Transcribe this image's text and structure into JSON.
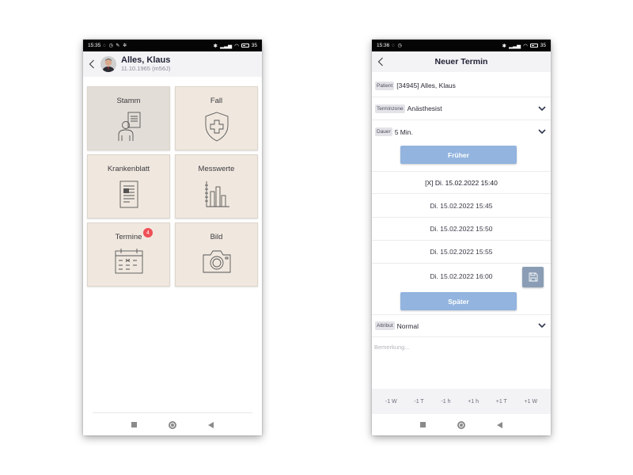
{
  "colors": {
    "tile_bg": "#f0e8df",
    "tile_active_bg": "#e2ddd6",
    "badge": "#ef4f55",
    "button_blue": "#92b4de",
    "save_button": "#8a9db5",
    "header_bg": "#f3f3f6"
  },
  "phone1": {
    "status": {
      "time": "15:35",
      "battery": "35"
    },
    "header": {
      "name": "Alles, Klaus",
      "sub": "11.10.1965 (m56J)"
    },
    "tiles": [
      {
        "label": "Stamm",
        "icon": "person-document-icon"
      },
      {
        "label": "Fall",
        "icon": "shield-cross-icon"
      },
      {
        "label": "Krankenblatt",
        "icon": "document-icon"
      },
      {
        "label": "Messwerte",
        "icon": "bar-chart-icon"
      },
      {
        "label": "Termine",
        "icon": "calendar-icon",
        "badge": "4"
      },
      {
        "label": "Bild",
        "icon": "camera-icon"
      }
    ]
  },
  "phone2": {
    "status": {
      "time": "15:36",
      "battery": "35"
    },
    "header": {
      "title": "Neuer Termin"
    },
    "fields": {
      "patient_label": "Patient",
      "patient_value": "[34945] Alles, Klaus",
      "zone_label": "Terminzone",
      "zone_value": "Anästhesist",
      "duration_label": "Dauer",
      "duration_value": "5 Min.",
      "attribute_label": "Attribut",
      "attribute_value": "Normal"
    },
    "earlier_label": "Früher",
    "later_label": "Später",
    "slots": [
      "[X] Di. 15.02.2022 15:40",
      "Di. 15.02.2022 15:45",
      "Di. 15.02.2022 15:50",
      "Di. 15.02.2022 15:55",
      "Di. 15.02.2022 16:00"
    ],
    "remark_placeholder": "Bemerkung...",
    "shift_buttons": [
      "-1 W",
      "-1 T",
      "-1 h",
      "+1 h",
      "+1 T",
      "+1 W"
    ]
  }
}
